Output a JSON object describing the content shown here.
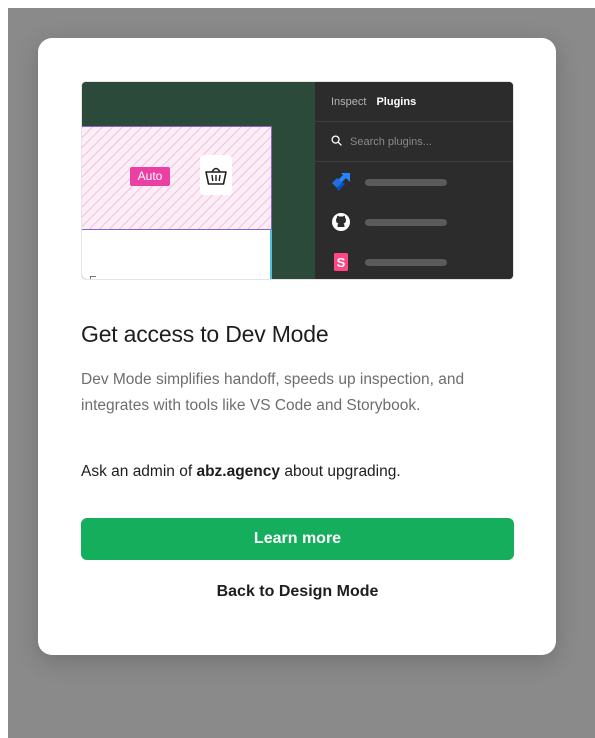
{
  "preview": {
    "badge_label": "Auto",
    "tabs": [
      {
        "label": "Inspect",
        "active": false
      },
      {
        "label": "Plugins",
        "active": true
      }
    ],
    "search_placeholder": "Search plugins...",
    "plugins": [
      {
        "icon": "jira-icon",
        "color": "#2684ff"
      },
      {
        "icon": "github-icon",
        "color": "#ffffff"
      },
      {
        "icon": "storybook-icon",
        "color": "#ff4785"
      }
    ]
  },
  "modal": {
    "title": "Get access to Dev Mode",
    "description": "Dev Mode simplifies handoff, speeds up inspection, and integrates with tools like VS Code and Storybook.",
    "ask_prefix": "Ask an admin of ",
    "ask_org": "abz.agency",
    "ask_suffix": " about upgrading.",
    "primary_button": "Learn more",
    "secondary_link": "Back to Design Mode"
  },
  "colors": {
    "primary": "#14ae5c",
    "badge": "#ea3fa3",
    "overlay": "#8a8a8a"
  }
}
